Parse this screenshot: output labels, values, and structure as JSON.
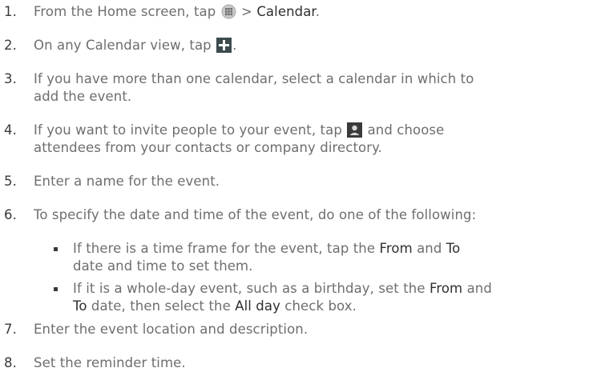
{
  "steps": [
    {
      "number": "1.",
      "parts": [
        "From the Home screen, tap ",
        " > ",
        "Calendar",
        "."
      ],
      "icon": "all-apps-grid-icon"
    },
    {
      "number": "2.",
      "parts": [
        "On any Calendar view, tap ",
        "."
      ],
      "icon": "add-plus-icon"
    },
    {
      "number": "3.",
      "lines": [
        "If you have more than one calendar, select a calendar in which to",
        "add the event."
      ]
    },
    {
      "number": "4.",
      "parts": [
        "If you want to invite people to your event, tap ",
        " and choose"
      ],
      "line2": "attendees from your contacts or company directory.",
      "icon": "contact-person-icon"
    },
    {
      "number": "5.",
      "text": "Enter a name for the event."
    },
    {
      "number": "6.",
      "text": "To specify the date and time of the event, do one of the following:"
    },
    {
      "number": "7.",
      "text": "Enter the event location and description."
    },
    {
      "number": "8.",
      "text": "Set the reminder time."
    }
  ],
  "bullets": [
    {
      "line1": [
        "If there is a time frame for the event, tap the ",
        "From",
        " and ",
        "To"
      ],
      "line2": "date and time to set them."
    },
    {
      "line1": [
        "If it is a whole-day event, such as a birthday, set the ",
        "From",
        " and"
      ],
      "line2": [
        "To",
        " date, then select the ",
        "All day",
        " check box."
      ]
    }
  ],
  "colors": {
    "text": "#6e6e6e",
    "emphasis": "#2f2f2f",
    "add_icon_bg": "#3d4b4f",
    "contact_icon_bg": "#3a3a3a"
  }
}
